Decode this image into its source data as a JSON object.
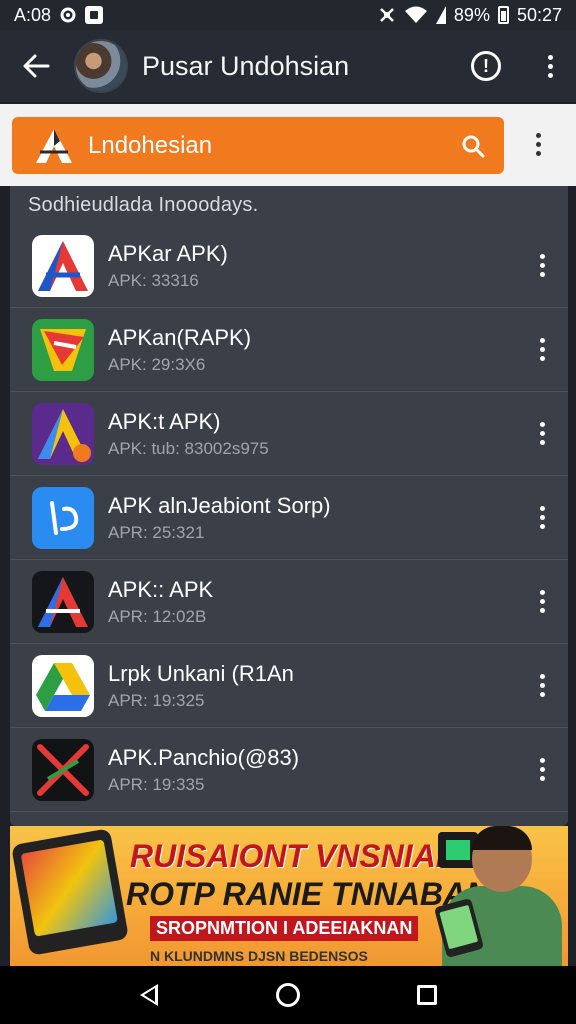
{
  "status_bar": {
    "time_left": "A:08",
    "battery_percent": "89%",
    "time_right": "50:27",
    "icons": [
      "gear-icon",
      "app-square-icon",
      "mute-icon",
      "wifi-icon",
      "signal-icon",
      "battery-icon"
    ]
  },
  "app_bar": {
    "title": "Pusar Undohsian",
    "back_icon": "arrow-left-icon",
    "info_icon": "alert-circle-icon",
    "menu_icon": "more-vertical-icon"
  },
  "search": {
    "value": "Lndohesian",
    "icon": "search-icon",
    "brand_color": "#f07a1d"
  },
  "section": {
    "header": "Sodhieudlada Inooodays."
  },
  "apps": [
    {
      "name": "APKar APK)",
      "sub": "APK: 33316",
      "icon": "apk-a-blue-icon"
    },
    {
      "name": "APKan(RAPK)",
      "sub": "APK: 29:3X6",
      "icon": "apk-green-red-icon"
    },
    {
      "name": "APK:t APK)",
      "sub": "APK: tub: 83002s975",
      "icon": "apk-purple-icon"
    },
    {
      "name": "APK alnJeabiont Sorp)",
      "sub": "APR: 25:321",
      "icon": "apk-blue-swirl-icon"
    },
    {
      "name": "APK:: APK",
      "sub": "APR: 12:02B",
      "icon": "apk-dark-a-icon"
    },
    {
      "name": "Lrpk Unkani (R1An",
      "sub": "APR: 19:325",
      "icon": "apk-drive-icon"
    },
    {
      "name": "APK.Panchio(@83)",
      "sub": "APR: 19:335",
      "icon": "apk-x-icon"
    }
  ],
  "ad": {
    "headline": "RUISAIONT VNSNIAN!",
    "subheadline": "ROTP RANIE TNNABAN",
    "tagline": "SROPNMTION I ADEEIAKNAN",
    "small_text": "N KLUNDMNS DJSN BEDENSOS"
  },
  "nav": {
    "back_icon": "nav-back-icon",
    "home_icon": "nav-home-icon",
    "recents_icon": "nav-recents-icon"
  }
}
